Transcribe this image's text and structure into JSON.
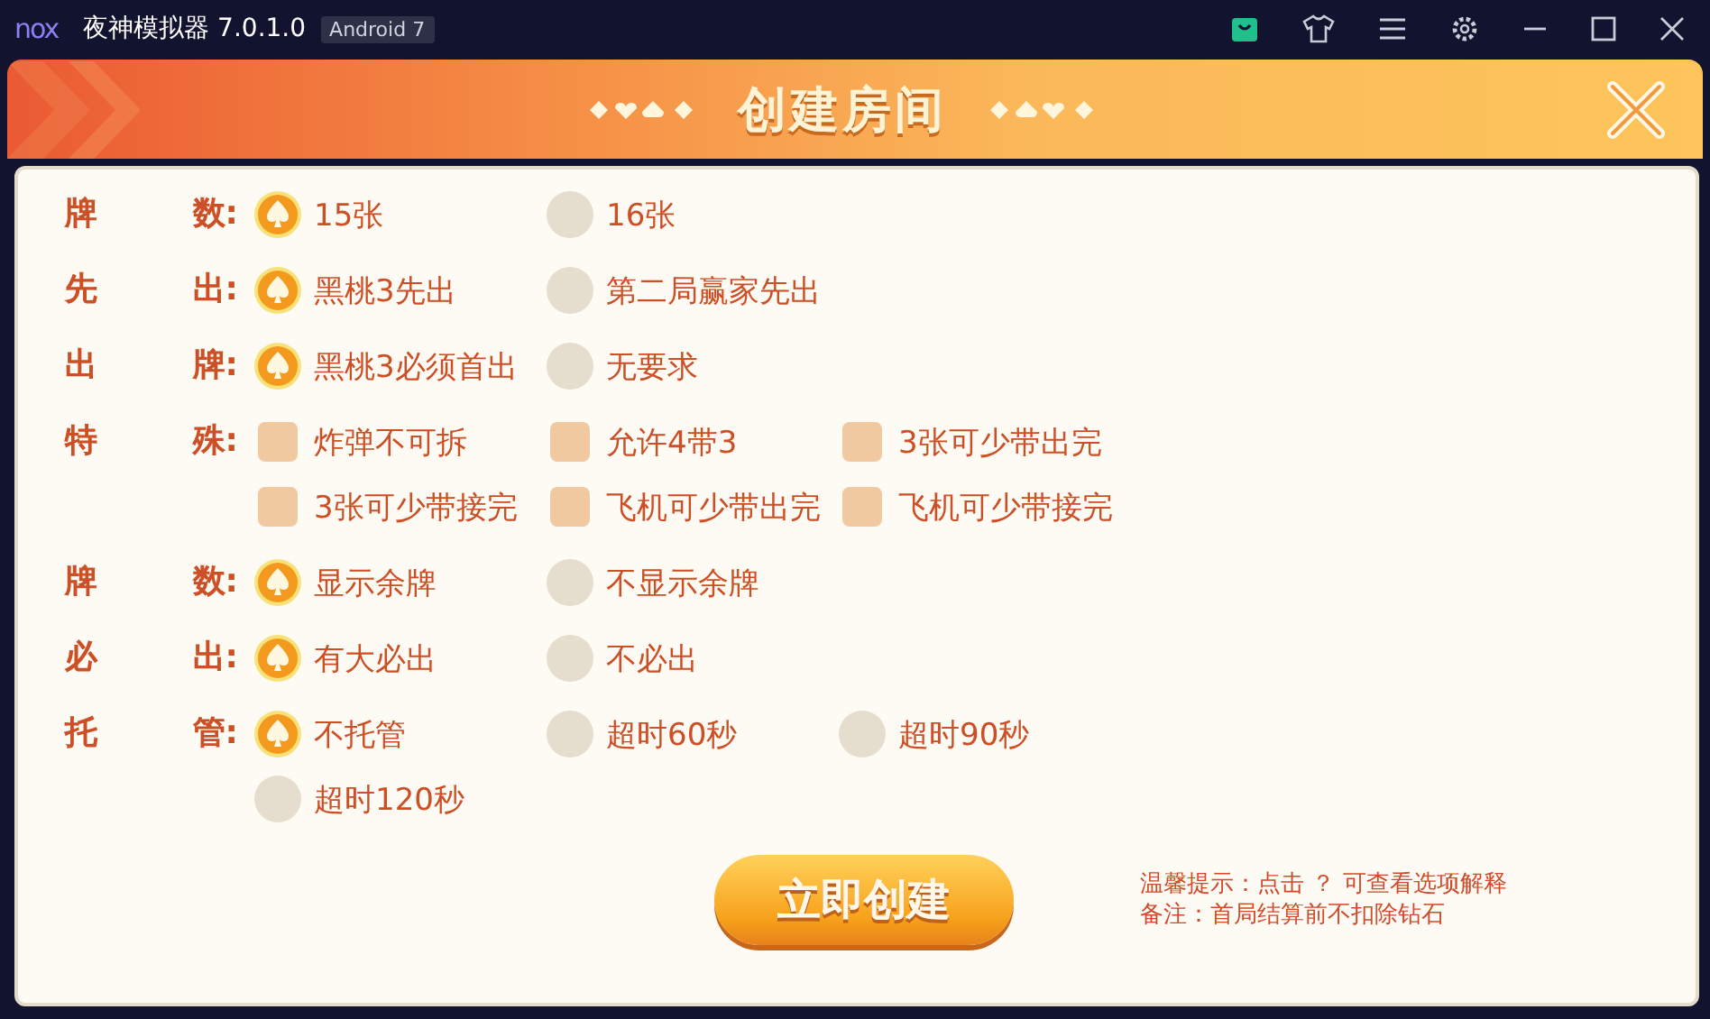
{
  "window": {
    "logo": "nox",
    "title": "夜神模拟器 7.0.1.0",
    "badge": "Android 7"
  },
  "dialog": {
    "title": "创建房间"
  },
  "rows": [
    {
      "label": [
        "牌",
        "数:"
      ],
      "kind": "radio",
      "options": [
        {
          "text": "15张",
          "selected": true
        },
        {
          "text": "16张",
          "selected": false
        }
      ]
    },
    {
      "label": [
        "先",
        "出:"
      ],
      "kind": "radio",
      "options": [
        {
          "text": "黑桃3先出",
          "selected": true
        },
        {
          "text": "第二局赢家先出",
          "selected": false
        }
      ]
    },
    {
      "label": [
        "出",
        "牌:"
      ],
      "kind": "radio",
      "options": [
        {
          "text": "黑桃3必须首出",
          "selected": true
        },
        {
          "text": "无要求",
          "selected": false
        }
      ]
    },
    {
      "label": [
        "特",
        "殊:"
      ],
      "kind": "checkbox",
      "options": [
        {
          "text": "炸弹不可拆",
          "checked": false
        },
        {
          "text": "允许4带3",
          "checked": false
        },
        {
          "text": "3张可少带出完",
          "checked": false
        },
        {
          "text": "3张可少带接完",
          "checked": false
        },
        {
          "text": "飞机可少带出完",
          "checked": false
        },
        {
          "text": "飞机可少带接完",
          "checked": false
        }
      ]
    },
    {
      "label": [
        "牌",
        "数:"
      ],
      "kind": "radio",
      "options": [
        {
          "text": "显示余牌",
          "selected": true
        },
        {
          "text": "不显示余牌",
          "selected": false
        }
      ]
    },
    {
      "label": [
        "必",
        "出:"
      ],
      "kind": "radio",
      "options": [
        {
          "text": "有大必出",
          "selected": true
        },
        {
          "text": "不必出",
          "selected": false
        }
      ]
    },
    {
      "label": [
        "托",
        "管:"
      ],
      "kind": "radio",
      "options": [
        {
          "text": "不托管",
          "selected": true
        },
        {
          "text": "超时60秒",
          "selected": false
        },
        {
          "text": "超时90秒",
          "selected": false
        },
        {
          "text": "超时120秒",
          "selected": false
        }
      ]
    }
  ],
  "create_button": "立即创建",
  "notes": [
    "温馨提示：点击 ？ 可查看选项解释",
    "备注：首局结算前不扣除钻石"
  ]
}
